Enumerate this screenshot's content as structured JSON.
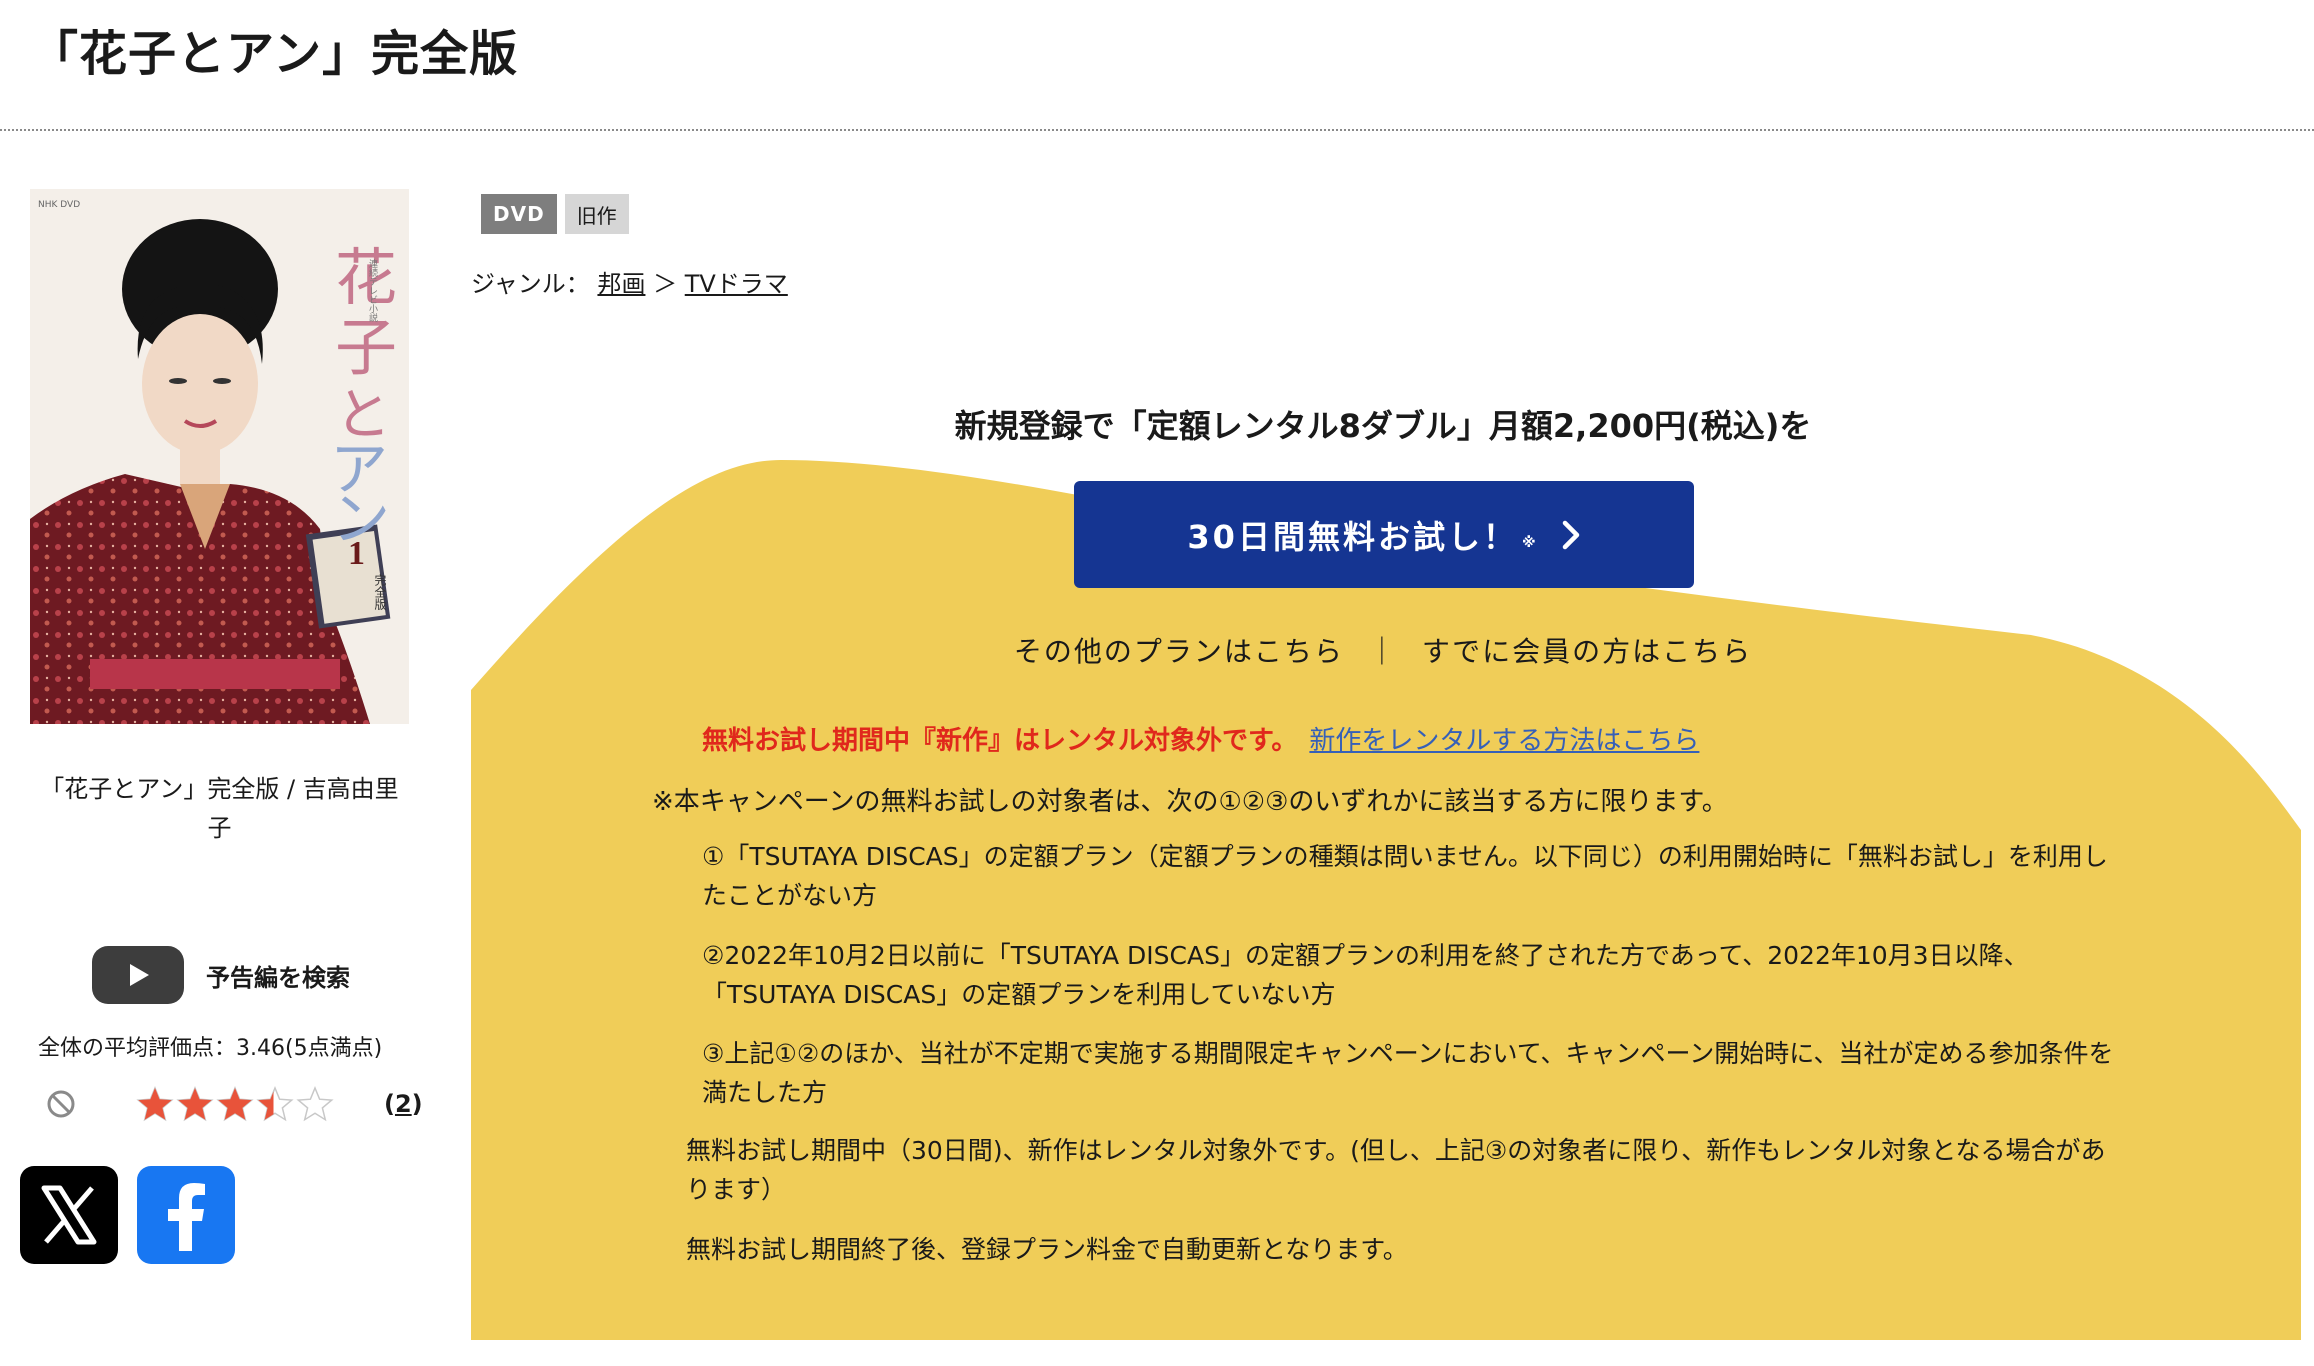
{
  "page": {
    "title": "「花子とアン」完全版"
  },
  "product": {
    "cover_logo_text": "NHK DVD",
    "cover_title_vertical": "花子とアン",
    "cover_subtitle": "連続テレビ小説",
    "cover_volume": "1",
    "cover_edition": "完全版",
    "name": "「花子とアン」完全版 / 吉高由里子",
    "badges": [
      "DVD",
      "旧作"
    ],
    "genre_label": "ジャンル：",
    "genre_path": [
      "邦画",
      "TVドラマ"
    ],
    "genre_sep": "＞"
  },
  "trailer": {
    "label": "予告編を検索",
    "icon": "youtube-play-icon"
  },
  "rating": {
    "avg_label": "全体の平均評価点：",
    "avg_value": "3.46(5点満点)",
    "stars": 3.46,
    "max_stars": 5,
    "count_prefix": "(",
    "count": "2",
    "count_suffix": ")",
    "no_icon": "prohibited-icon"
  },
  "social": {
    "icons": [
      "x-logo-icon",
      "facebook-logo-icon"
    ]
  },
  "campaign": {
    "headline": "新規登録で「定額レンタル8ダブル」月額2,200円(税込)を",
    "cta_label": "30日間無料お試し！",
    "cta_note": "※",
    "other_plans": "その他のプランはこちら",
    "separator": "｜",
    "member_link": "すでに会員の方はこちら",
    "warning": "無料お試し期間中『新作』はレンタル対象外です。",
    "warning_link": "新作をレンタルする方法はこちら",
    "note_head": "※本キャンペーンの無料お試しの対象者は、次の①②③のいずれかに該当する方に限ります。",
    "conditions": [
      "①「TSUTAYA DISCAS」の定額プラン（定額プランの種類は問いません。以下同じ）の利用開始時に「無料お試し」を利用したことがない方",
      "②2022年10月2日以前に「TSUTAYA DISCAS」の定額プランの利用を終了された方であって、2022年10月3日以降、「TSUTAYA DISCAS」の定額プランを利用していない方",
      "③上記①②のほか、当社が不定期で実施する期間限定キャンペーンにおいて、キャンペーン開始時に、当社が定める参加条件を満たした方"
    ],
    "trial_note_1": "無料お試し期間中（30日間)、新作はレンタル対象外です。(但し、上記③の対象者に限り、新作もレンタル対象となる場合があります）",
    "trial_note_2": "無料お試し期間終了後、登録プラン料金で自動更新となります。"
  },
  "colors": {
    "campaign_bg": "#f0cd58",
    "cta_bg": "#153592",
    "warning_red": "#e0281c",
    "link_blue": "#3660b8",
    "star": "#e8533a",
    "badge_dvd": "#7e7e7e",
    "badge_old": "#d6d6d6"
  }
}
